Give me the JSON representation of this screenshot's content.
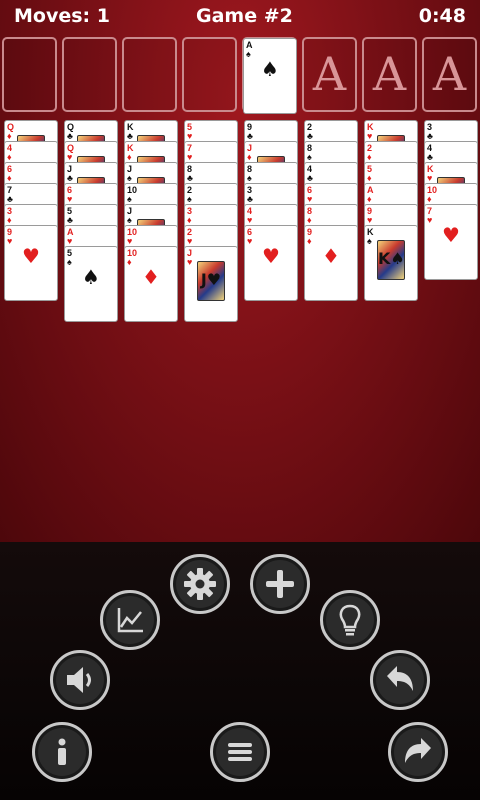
{
  "status_bar": {
    "moves": "Moves: 1",
    "game": "Game #2",
    "timer": "0:48"
  },
  "free_cells": [
    {
      "label": "free-cell-1"
    },
    {
      "label": "free-cell-2"
    },
    {
      "label": "free-cell-3"
    },
    {
      "label": "free-cell-4"
    }
  ],
  "foundations": [
    {
      "top_card": {
        "rank": "A",
        "suit": "♠",
        "color": "black"
      },
      "placeholder": ""
    },
    {
      "top_card": null,
      "placeholder": "A"
    },
    {
      "top_card": null,
      "placeholder": "A"
    },
    {
      "top_card": null,
      "placeholder": "A"
    }
  ],
  "tableau": [
    [
      {
        "rank": "Q",
        "suit": "♦",
        "color": "red"
      },
      {
        "rank": "4",
        "suit": "♦",
        "color": "red"
      },
      {
        "rank": "6",
        "suit": "♦",
        "color": "red"
      },
      {
        "rank": "7",
        "suit": "♣",
        "color": "black"
      },
      {
        "rank": "3",
        "suit": "♦",
        "color": "red"
      },
      {
        "rank": "9",
        "suit": "♥",
        "color": "red"
      }
    ],
    [
      {
        "rank": "Q",
        "suit": "♣",
        "color": "black"
      },
      {
        "rank": "Q",
        "suit": "♥",
        "color": "red"
      },
      {
        "rank": "J",
        "suit": "♣",
        "color": "black"
      },
      {
        "rank": "6",
        "suit": "♥",
        "color": "red"
      },
      {
        "rank": "5",
        "suit": "♣",
        "color": "black"
      },
      {
        "rank": "A",
        "suit": "♥",
        "color": "red"
      },
      {
        "rank": "5",
        "suit": "♠",
        "color": "black"
      }
    ],
    [
      {
        "rank": "K",
        "suit": "♣",
        "color": "black"
      },
      {
        "rank": "K",
        "suit": "♦",
        "color": "red"
      },
      {
        "rank": "J",
        "suit": "♠",
        "color": "black"
      },
      {
        "rank": "10",
        "suit": "♠",
        "color": "black"
      },
      {
        "rank": "J",
        "suit": "♠",
        "color": "black"
      },
      {
        "rank": "10",
        "suit": "♥",
        "color": "red"
      },
      {
        "rank": "10",
        "suit": "♦",
        "color": "red"
      }
    ],
    [
      {
        "rank": "5",
        "suit": "♥",
        "color": "red"
      },
      {
        "rank": "7",
        "suit": "♥",
        "color": "red"
      },
      {
        "rank": "8",
        "suit": "♣",
        "color": "black"
      },
      {
        "rank": "2",
        "suit": "♠",
        "color": "black"
      },
      {
        "rank": "3",
        "suit": "♦",
        "color": "red"
      },
      {
        "rank": "2",
        "suit": "♥",
        "color": "red"
      },
      {
        "rank": "J",
        "suit": "♥",
        "color": "red"
      }
    ],
    [
      {
        "rank": "9",
        "suit": "♣",
        "color": "black"
      },
      {
        "rank": "J",
        "suit": "♦",
        "color": "red"
      },
      {
        "rank": "8",
        "suit": "♠",
        "color": "black"
      },
      {
        "rank": "3",
        "suit": "♣",
        "color": "black"
      },
      {
        "rank": "4",
        "suit": "♥",
        "color": "red"
      },
      {
        "rank": "6",
        "suit": "♥",
        "color": "red"
      }
    ],
    [
      {
        "rank": "2",
        "suit": "♣",
        "color": "black"
      },
      {
        "rank": "8",
        "suit": "♠",
        "color": "black"
      },
      {
        "rank": "4",
        "suit": "♣",
        "color": "black"
      },
      {
        "rank": "6",
        "suit": "♥",
        "color": "red"
      },
      {
        "rank": "8",
        "suit": "♦",
        "color": "red"
      },
      {
        "rank": "9",
        "suit": "♦",
        "color": "red"
      }
    ],
    [
      {
        "rank": "K",
        "suit": "♥",
        "color": "red"
      },
      {
        "rank": "2",
        "suit": "♦",
        "color": "red"
      },
      {
        "rank": "5",
        "suit": "♦",
        "color": "red"
      },
      {
        "rank": "A",
        "suit": "♦",
        "color": "red"
      },
      {
        "rank": "9",
        "suit": "♥",
        "color": "red"
      },
      {
        "rank": "K",
        "suit": "♠",
        "color": "black"
      }
    ],
    [
      {
        "rank": "3",
        "suit": "♣",
        "color": "black"
      },
      {
        "rank": "4",
        "suit": "♣",
        "color": "black"
      },
      {
        "rank": "K",
        "suit": "♥",
        "color": "red"
      },
      {
        "rank": "10",
        "suit": "♦",
        "color": "red"
      },
      {
        "rank": "7",
        "suit": "♥",
        "color": "red"
      }
    ]
  ],
  "controls": [
    {
      "name": "info-button",
      "icon": "info-icon"
    },
    {
      "name": "sound-button",
      "icon": "speaker-icon"
    },
    {
      "name": "statistics-button",
      "icon": "chart-icon"
    },
    {
      "name": "settings-button",
      "icon": "gear-icon"
    },
    {
      "name": "new-game-button",
      "icon": "plus-icon"
    },
    {
      "name": "hint-button",
      "icon": "lightbulb-icon"
    },
    {
      "name": "undo-button",
      "icon": "undo-icon"
    },
    {
      "name": "menu-button",
      "icon": "menu-icon"
    },
    {
      "name": "redo-button",
      "icon": "redo-icon"
    }
  ]
}
